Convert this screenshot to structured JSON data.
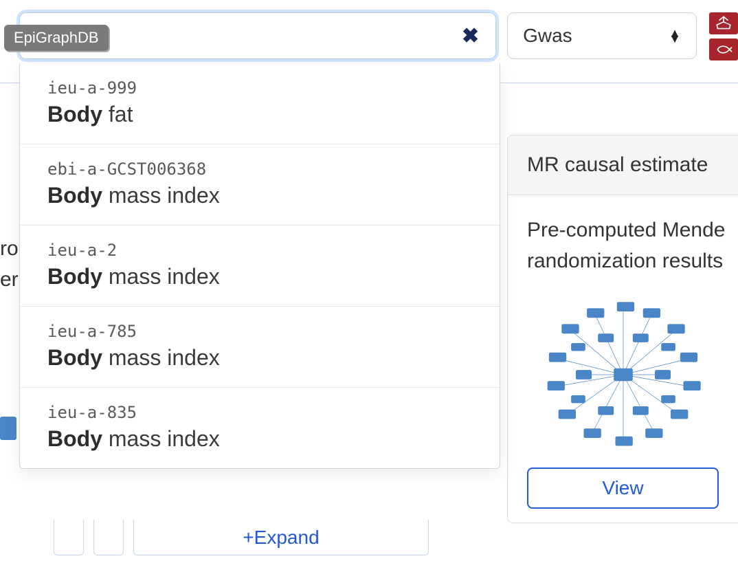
{
  "brand_tag": "EpiGraphDB",
  "search": {
    "value": "",
    "placeholder": ""
  },
  "type_select": {
    "value": "Gwas"
  },
  "autocomplete": [
    {
      "id": "ieu-a-999",
      "bold": "Body",
      "rest": " fat"
    },
    {
      "id": "ebi-a-GCST006368",
      "bold": "Body",
      "rest": " mass index"
    },
    {
      "id": "ieu-a-2",
      "bold": "Body",
      "rest": " mass index"
    },
    {
      "id": "ieu-a-785",
      "bold": "Body",
      "rest": " mass index"
    },
    {
      "id": "ieu-a-835",
      "bold": "Body",
      "rest": " mass index"
    }
  ],
  "right_card": {
    "title": "MR causal estimate",
    "desc_line1": "Pre-computed Mende",
    "desc_line2": "randomization results",
    "view_label": "View"
  },
  "background": {
    "frag1": "ro",
    "frag2": "er",
    "expand_label": "+Expand"
  }
}
